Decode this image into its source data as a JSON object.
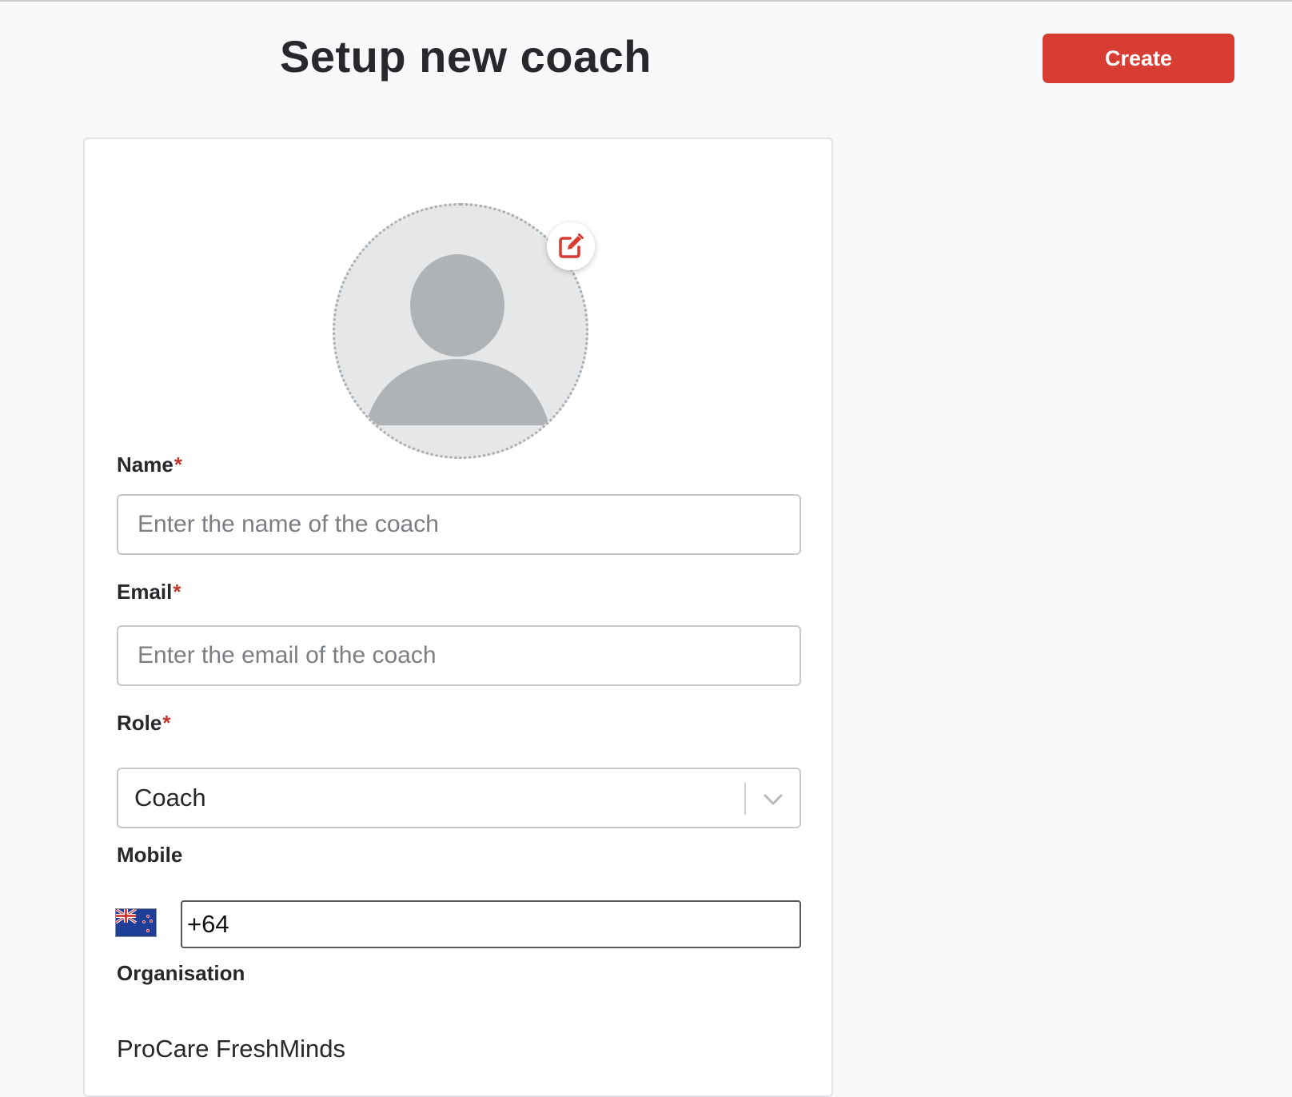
{
  "header": {
    "title": "Setup new coach",
    "create_label": "Create"
  },
  "colors": {
    "accent": "#d83d34",
    "page_background": "#f7f8f9",
    "avatar_fill": "#e6e7e8",
    "avatar_silhouette": "#afb3b6"
  },
  "avatar": {
    "icon": "user-silhouette-icon",
    "edit_icon": "edit-icon"
  },
  "form": {
    "name": {
      "label": "Name",
      "required_mark": "*",
      "placeholder": "Enter the name of the coach",
      "value": ""
    },
    "email": {
      "label": "Email",
      "required_mark": "*",
      "placeholder": "Enter the email of the coach",
      "value": ""
    },
    "role": {
      "label": "Role",
      "required_mark": "*",
      "selected": "Coach",
      "icon": "chevron-down-icon"
    },
    "mobile": {
      "label": "Mobile",
      "country_flag": "new-zealand-flag-icon",
      "value": "+64"
    },
    "organisation": {
      "label": "Organisation",
      "value": "ProCare FreshMinds"
    }
  }
}
